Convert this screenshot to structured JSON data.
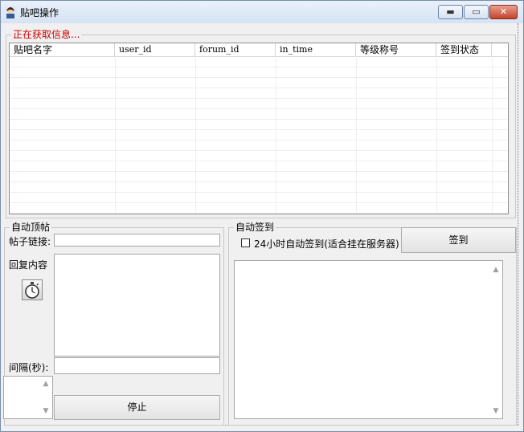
{
  "window": {
    "title": "贴吧操作",
    "icon": "user-avatar-icon",
    "min_glyph": "▬",
    "max_glyph": "▭",
    "close_glyph": "✕"
  },
  "status_group": {
    "legend": "正在获取信息...",
    "legend_color": "#cc0000"
  },
  "table": {
    "columns": [
      "贴吧名字",
      "user_id",
      "forum_id",
      "in_time",
      "等级称号",
      "签到状态"
    ],
    "rows": []
  },
  "auto_bump": {
    "legend": "自动顶帖",
    "post_link_label": "帖子链接:",
    "post_link_value": "",
    "reply_label": "回复内容",
    "reply_value": "",
    "interval_label": "间隔(秒):",
    "interval_value": "",
    "stop_label": "停止",
    "timer_icon": "stopwatch-icon"
  },
  "auto_signin": {
    "legend": "自动签到",
    "checkbox_label": "24小时自动签到(适合挂在服务器)",
    "checkbox_checked": false,
    "signin_label": "签到",
    "log_value": ""
  }
}
